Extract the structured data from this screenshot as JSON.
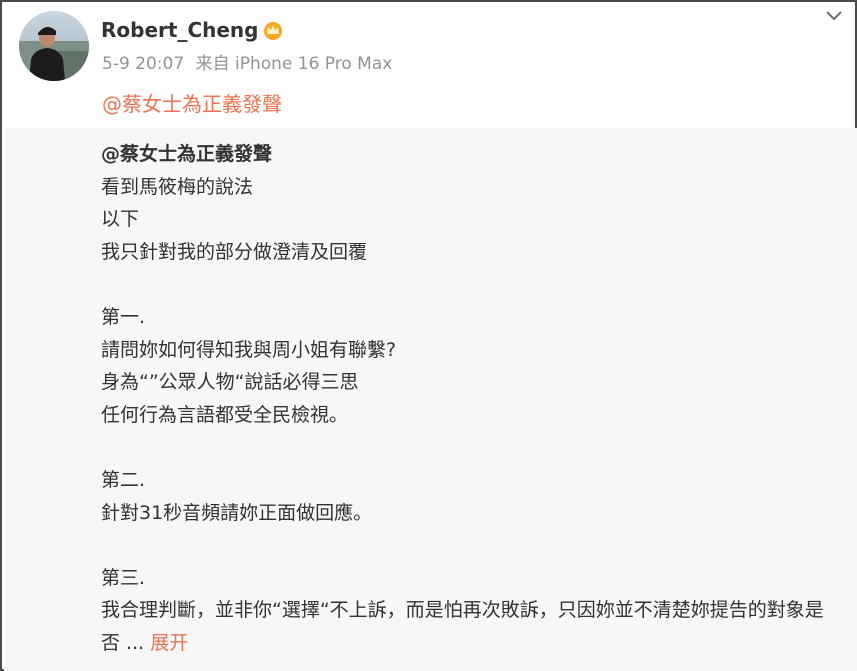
{
  "post": {
    "username": "Robert_Cheng",
    "badge_icon": "crown-badge-icon",
    "timestamp": "5-9 20:07",
    "source": "来自 iPhone 16 Pro Max",
    "mention": "@蔡女士為正義發聲"
  },
  "repost": {
    "lines": [
      "@蔡女士為正義發聲",
      "看到馬筱梅的說法",
      "以下",
      "我只針對我的部分做澄清及回覆",
      "",
      "第一.",
      "請問妳如何得知我與周小姐有聯繫?",
      "身為“”公眾人物“說話必得三思",
      "任何行為言語都受全民檢視。",
      "",
      "第二.",
      "針對31秒音頻請妳正面做回應。",
      "",
      "第三.",
      "我合理判斷，並非你“選擇“不上訴，而是怕再次敗訴，只因妳並不清楚妳提告的對象是",
      "否 ..."
    ],
    "expand_label": "展开"
  },
  "colors": {
    "accent": "#eb7350",
    "meta": "#939393",
    "repost_bg": "#f7f7f7"
  }
}
